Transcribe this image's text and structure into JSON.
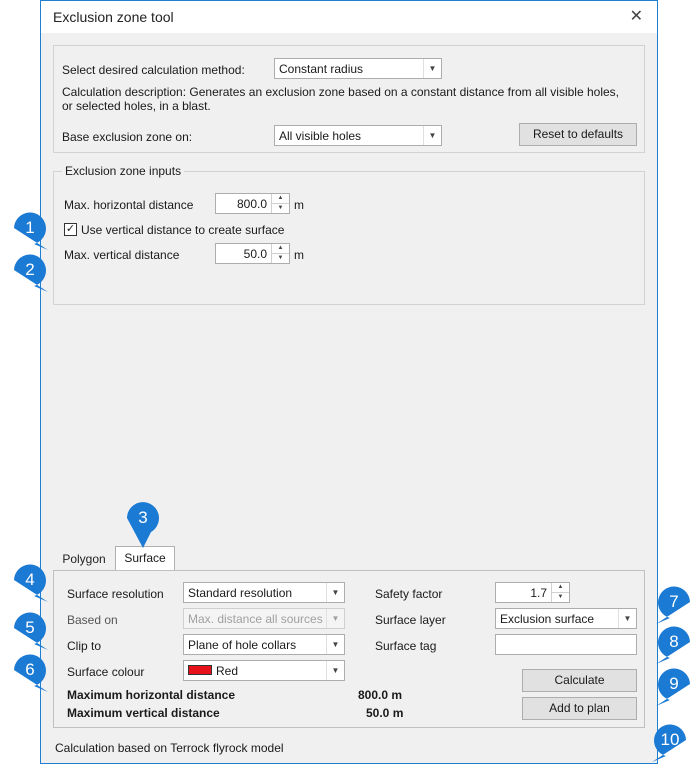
{
  "window": {
    "title": "Exclusion zone tool",
    "close_glyph": "✕"
  },
  "method": {
    "select_label": "Select desired calculation method:",
    "select_value": "Constant radius",
    "description": "Calculation description: Generates an exclusion zone based on a constant distance from all visible holes, or selected holes, in a blast.",
    "base_label": "Base exclusion zone on:",
    "base_value": "All visible holes",
    "reset_button": "Reset to defaults"
  },
  "inputs": {
    "legend": "Exclusion zone inputs",
    "max_horizontal_label": "Max. horizontal distance",
    "max_horizontal_value": "800.0",
    "max_horizontal_unit": "m",
    "use_vertical_label": "Use vertical distance to create surface",
    "use_vertical_checked": true,
    "max_vertical_label": "Max. vertical distance",
    "max_vertical_value": "50.0",
    "max_vertical_unit": "m"
  },
  "tabs": [
    {
      "label": "Polygon",
      "active": false
    },
    {
      "label": "Surface",
      "active": true
    }
  ],
  "surface": {
    "resolution_label": "Surface resolution",
    "resolution_value": "Standard resolution",
    "based_on_label": "Based on",
    "based_on_value": "Max. distance all sources",
    "clip_label": "Clip to",
    "clip_value": "Plane of hole collars",
    "colour_label": "Surface colour",
    "colour_value": "Red",
    "colour_hex": "#e8131a",
    "safety_label": "Safety factor",
    "safety_value": "1.7",
    "layer_label": "Surface layer",
    "layer_value": "Exclusion surface",
    "tag_label": "Surface tag",
    "tag_value": "",
    "max_h_summary_label": "Maximum horizontal distance",
    "max_h_summary_value": "800.0 m",
    "max_v_summary_label": "Maximum vertical distance",
    "max_v_summary_value": "50.0 m",
    "calculate_button": "Calculate",
    "add_button": "Add to plan"
  },
  "footer": "Calculation based on Terrock flyrock model",
  "callouts": [
    "1",
    "2",
    "3",
    "4",
    "5",
    "6",
    "7",
    "8",
    "9",
    "10"
  ],
  "callout_color": "#1b7ad3"
}
